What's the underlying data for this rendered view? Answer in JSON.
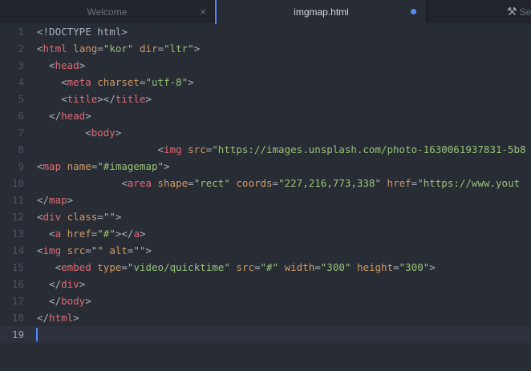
{
  "tabs": [
    {
      "label": "Welcome",
      "active": false,
      "close": "×"
    },
    {
      "label": "imgmap.html",
      "active": true,
      "modified": true
    },
    {
      "label": "Se",
      "icon": "wrench-screwdriver-icon"
    }
  ],
  "editor": {
    "current_line": 19,
    "lines": [
      {
        "n": "1",
        "segs": [
          [
            "p",
            "<!DOCTYPE html>"
          ]
        ]
      },
      {
        "n": "2",
        "segs": [
          [
            "p",
            "<"
          ],
          [
            "t",
            "html"
          ],
          [
            "p",
            " "
          ],
          [
            "a",
            "lang"
          ],
          [
            "p",
            "="
          ],
          [
            "s",
            "\"kor\""
          ],
          [
            "p",
            " "
          ],
          [
            "a",
            "dir"
          ],
          [
            "p",
            "="
          ],
          [
            "s",
            "\"ltr\""
          ],
          [
            "p",
            ">"
          ]
        ]
      },
      {
        "n": "3",
        "segs": [
          [
            "p",
            "  <"
          ],
          [
            "t",
            "head"
          ],
          [
            "p",
            ">"
          ]
        ]
      },
      {
        "n": "4",
        "segs": [
          [
            "p",
            "    <"
          ],
          [
            "t",
            "meta"
          ],
          [
            "p",
            " "
          ],
          [
            "a",
            "charset"
          ],
          [
            "p",
            "="
          ],
          [
            "s",
            "\"utf-8\""
          ],
          [
            "p",
            ">"
          ]
        ]
      },
      {
        "n": "5",
        "segs": [
          [
            "p",
            "    <"
          ],
          [
            "t",
            "title"
          ],
          [
            "p",
            "></"
          ],
          [
            "t",
            "title"
          ],
          [
            "p",
            ">"
          ]
        ]
      },
      {
        "n": "6",
        "segs": [
          [
            "p",
            "  </"
          ],
          [
            "t",
            "head"
          ],
          [
            "p",
            ">"
          ]
        ]
      },
      {
        "n": "7",
        "segs": [
          [
            "p",
            "        <"
          ],
          [
            "t",
            "body"
          ],
          [
            "p",
            ">"
          ]
        ]
      },
      {
        "n": "8",
        "segs": [
          [
            "p",
            "                    <"
          ],
          [
            "t",
            "img"
          ],
          [
            "p",
            " "
          ],
          [
            "a",
            "src"
          ],
          [
            "p",
            "="
          ],
          [
            "s",
            "\"https://images.unsplash.com/photo-1630061937831-5b8"
          ]
        ]
      },
      {
        "n": "9",
        "segs": [
          [
            "p",
            "<"
          ],
          [
            "t",
            "map"
          ],
          [
            "p",
            " "
          ],
          [
            "a",
            "name"
          ],
          [
            "p",
            "="
          ],
          [
            "s",
            "\"#imagemap\""
          ],
          [
            "p",
            ">"
          ]
        ]
      },
      {
        "n": "10",
        "segs": [
          [
            "p",
            "              <"
          ],
          [
            "t",
            "area"
          ],
          [
            "p",
            " "
          ],
          [
            "a",
            "shape"
          ],
          [
            "p",
            "="
          ],
          [
            "s",
            "\"rect\""
          ],
          [
            "p",
            " "
          ],
          [
            "a",
            "coords"
          ],
          [
            "p",
            "="
          ],
          [
            "s",
            "\"227,216,773,338\""
          ],
          [
            "p",
            " "
          ],
          [
            "a",
            "href"
          ],
          [
            "p",
            "="
          ],
          [
            "s",
            "\"https://www.yout"
          ]
        ]
      },
      {
        "n": "11",
        "segs": [
          [
            "p",
            "</"
          ],
          [
            "t",
            "map"
          ],
          [
            "p",
            ">"
          ]
        ]
      },
      {
        "n": "12",
        "segs": [
          [
            "p",
            "<"
          ],
          [
            "t",
            "div"
          ],
          [
            "p",
            " "
          ],
          [
            "a",
            "class"
          ],
          [
            "p",
            "="
          ],
          [
            "s",
            "\"\""
          ],
          [
            "p",
            ">"
          ]
        ]
      },
      {
        "n": "13",
        "segs": [
          [
            "p",
            "  <"
          ],
          [
            "t",
            "a"
          ],
          [
            "p",
            " "
          ],
          [
            "a",
            "href"
          ],
          [
            "p",
            "="
          ],
          [
            "s",
            "\"#\""
          ],
          [
            "p",
            "></"
          ],
          [
            "t",
            "a"
          ],
          [
            "p",
            ">"
          ]
        ]
      },
      {
        "n": "14",
        "segs": [
          [
            "p",
            "<"
          ],
          [
            "t",
            "img"
          ],
          [
            "p",
            " "
          ],
          [
            "a",
            "src"
          ],
          [
            "p",
            "="
          ],
          [
            "s",
            "\"\""
          ],
          [
            "p",
            " "
          ],
          [
            "a",
            "alt"
          ],
          [
            "p",
            "="
          ],
          [
            "s",
            "\"\""
          ],
          [
            "p",
            ">"
          ]
        ]
      },
      {
        "n": "15",
        "segs": [
          [
            "p",
            "   <"
          ],
          [
            "t",
            "embed"
          ],
          [
            "p",
            " "
          ],
          [
            "a",
            "type"
          ],
          [
            "p",
            "="
          ],
          [
            "s",
            "\"video/quicktime\""
          ],
          [
            "p",
            " "
          ],
          [
            "a",
            "src"
          ],
          [
            "p",
            "="
          ],
          [
            "s",
            "\"#\""
          ],
          [
            "p",
            " "
          ],
          [
            "a",
            "width"
          ],
          [
            "p",
            "="
          ],
          [
            "s",
            "\"300\""
          ],
          [
            "p",
            " "
          ],
          [
            "a",
            "height"
          ],
          [
            "p",
            "="
          ],
          [
            "s",
            "\"300\""
          ],
          [
            "p",
            ">"
          ]
        ]
      },
      {
        "n": "16",
        "segs": [
          [
            "p",
            "  </"
          ],
          [
            "t",
            "div"
          ],
          [
            "p",
            ">"
          ]
        ]
      },
      {
        "n": "17",
        "segs": [
          [
            "p",
            "  </"
          ],
          [
            "t",
            "body"
          ],
          [
            "p",
            ">"
          ]
        ]
      },
      {
        "n": "18",
        "segs": [
          [
            "p",
            "</"
          ],
          [
            "t",
            "html"
          ],
          [
            "p",
            ">"
          ]
        ]
      },
      {
        "n": "19",
        "segs": []
      }
    ]
  }
}
